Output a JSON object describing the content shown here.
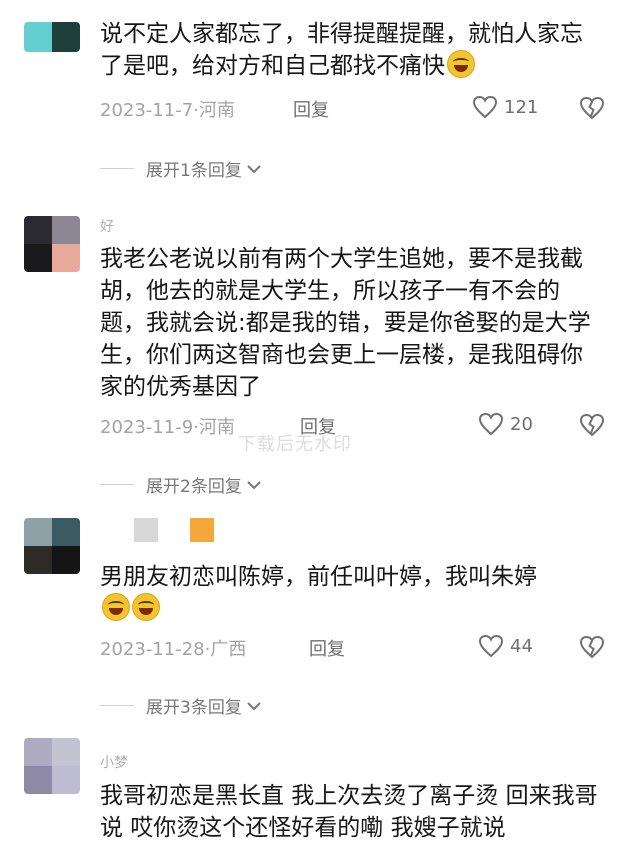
{
  "comments": [
    {
      "username": "",
      "text": "说不定人家都忘了，非得提醒提醒，就怕人家忘了是吧，给对方和自己都找不痛快",
      "emoji_count": 1,
      "date": "2023-11-7",
      "location": "河南",
      "reply_label": "回复",
      "likes": "121",
      "expand_label": "展开1条回复",
      "avatar_colors": [
        "#63cfd0",
        "#1f3f3b",
        "#63cfd0",
        "#1f3f3b"
      ]
    },
    {
      "username": "好",
      "text": "我老公老说以前有两个大学生追她，要不是我截胡，他去的就是大学生，所以孩子一有不会的题，我就会说:都是我的错，要是你爸娶的是大学生，你们两这智商也会更上一层楼，是我阻碍你家的优秀基因了",
      "emoji_count": 0,
      "date": "2023-11-9",
      "location": "河南",
      "reply_label": "回复",
      "likes": "20",
      "expand_label": "展开2条回复",
      "avatar_colors": [
        "#2a2a30",
        "#8a8694",
        "#1a1a1c",
        "#e8a89a"
      ]
    },
    {
      "username": "",
      "text": "男朋友初恋叫陈婷，前任叫叶婷，我叫朱婷",
      "emoji_count": 2,
      "date": "2023-11-28",
      "location": "广西",
      "reply_label": "回复",
      "likes": "44",
      "expand_label": "展开3条回复",
      "avatar_colors": [
        "#8ca2a6",
        "#3c5a62",
        "#2e2a26",
        "#151515"
      ]
    },
    {
      "username": "小梦",
      "text": "我哥初恋是黑长直 我上次去烫了离子烫 回来我哥说 哎你烫这个还怪好看的嘞 我嫂子就说",
      "emoji_count": 0,
      "date": "",
      "location": "",
      "reply_label": "",
      "likes": "",
      "expand_label": "",
      "avatar_colors": [
        "#aeaac0",
        "#c4c3d4",
        "#8e8aa6",
        "#bdbcd0"
      ]
    }
  ],
  "watermark": "下载后无水印",
  "icons": {
    "like": "heart-outline-icon",
    "dislike": "broken-heart-icon",
    "expand": "chevron-down-icon",
    "emoji": "laughing-tears-emoji"
  },
  "colors": {
    "text": "#161616",
    "meta": "#a3a3a3",
    "link": "#6f6f6f"
  }
}
